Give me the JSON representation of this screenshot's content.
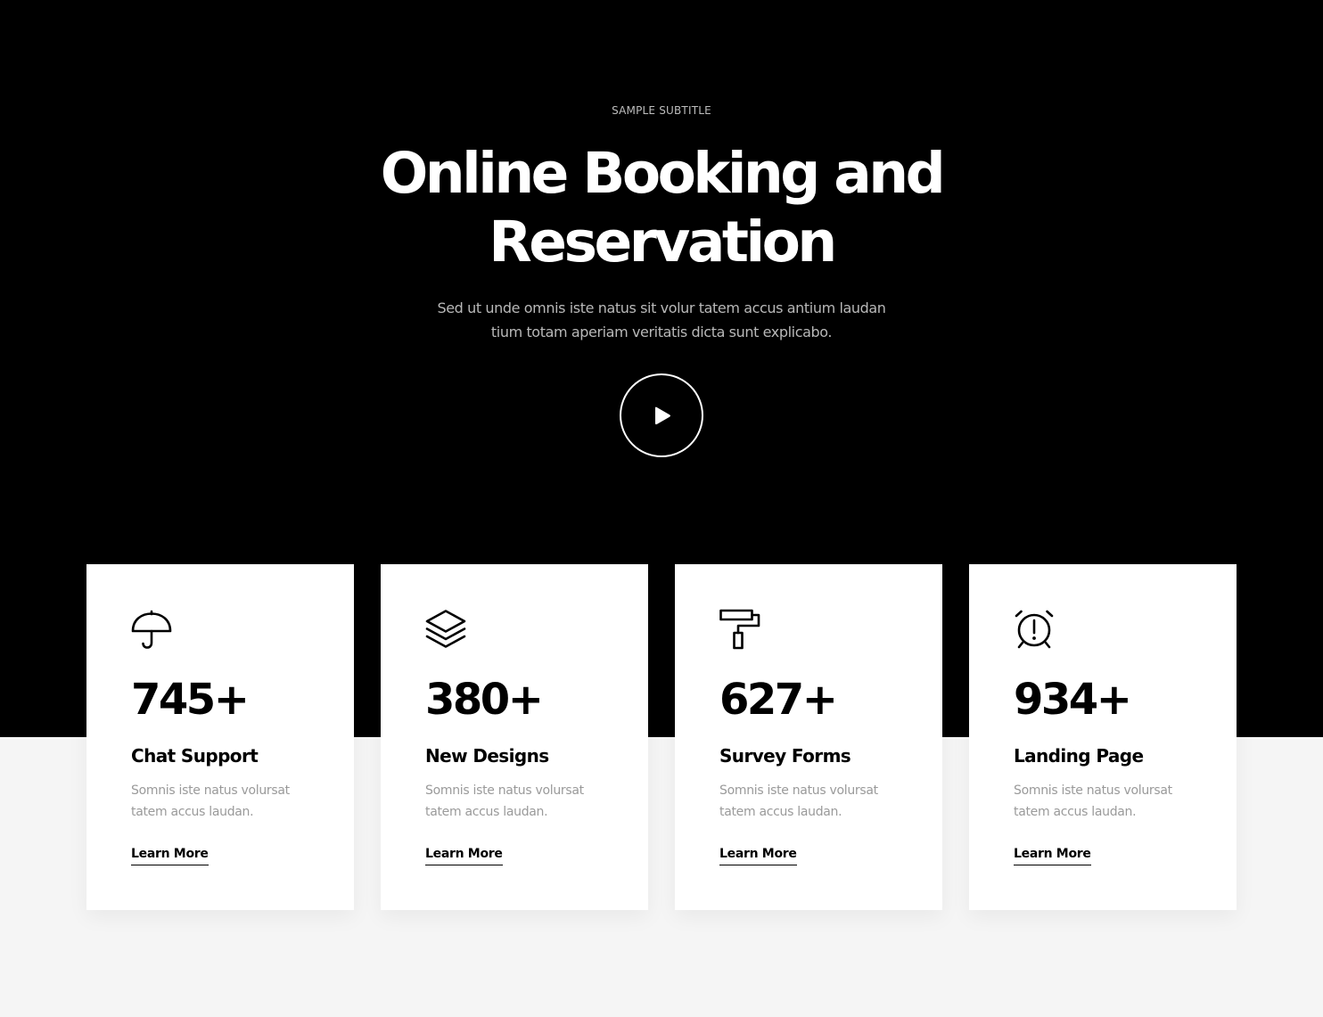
{
  "hero": {
    "subtitle": "SAMPLE SUBTITLE",
    "title_line_1": "Online Booking and",
    "title_line_2": "Reservation",
    "description_line_1": "Sed ut unde omnis iste natus sit volur tatem accus antium laudan",
    "description_line_2": "tium totam aperiam veritatis dicta sunt explicabo.",
    "play_icon": "play-icon"
  },
  "cards": [
    {
      "icon": "umbrella-icon",
      "number": "745+",
      "label": "Chat Support",
      "desc_line_1": "Somnis iste natus volursat",
      "desc_line_2": "tatem accus laudan.",
      "link": "Learn More"
    },
    {
      "icon": "layers-icon",
      "number": "380+",
      "label": "New Designs",
      "desc_line_1": "Somnis iste natus volursat",
      "desc_line_2": "tatem accus laudan.",
      "link": "Learn More"
    },
    {
      "icon": "paint-roller-icon",
      "number": "627+",
      "label": "Survey Forms",
      "desc_line_1": "Somnis iste natus volursat",
      "desc_line_2": "tatem accus laudan.",
      "link": "Learn More"
    },
    {
      "icon": "alarm-clock-alert-icon",
      "number": "934+",
      "label": "Landing Page",
      "desc_line_1": "Somnis iste natus volursat",
      "desc_line_2": "tatem accus laudan.",
      "link": "Learn More"
    }
  ],
  "colors": {
    "hero_background": "#000000",
    "page_background": "#f5f5f5",
    "card_background": "#ffffff",
    "text_primary": "#000000",
    "text_muted": "#9a9a9a"
  }
}
